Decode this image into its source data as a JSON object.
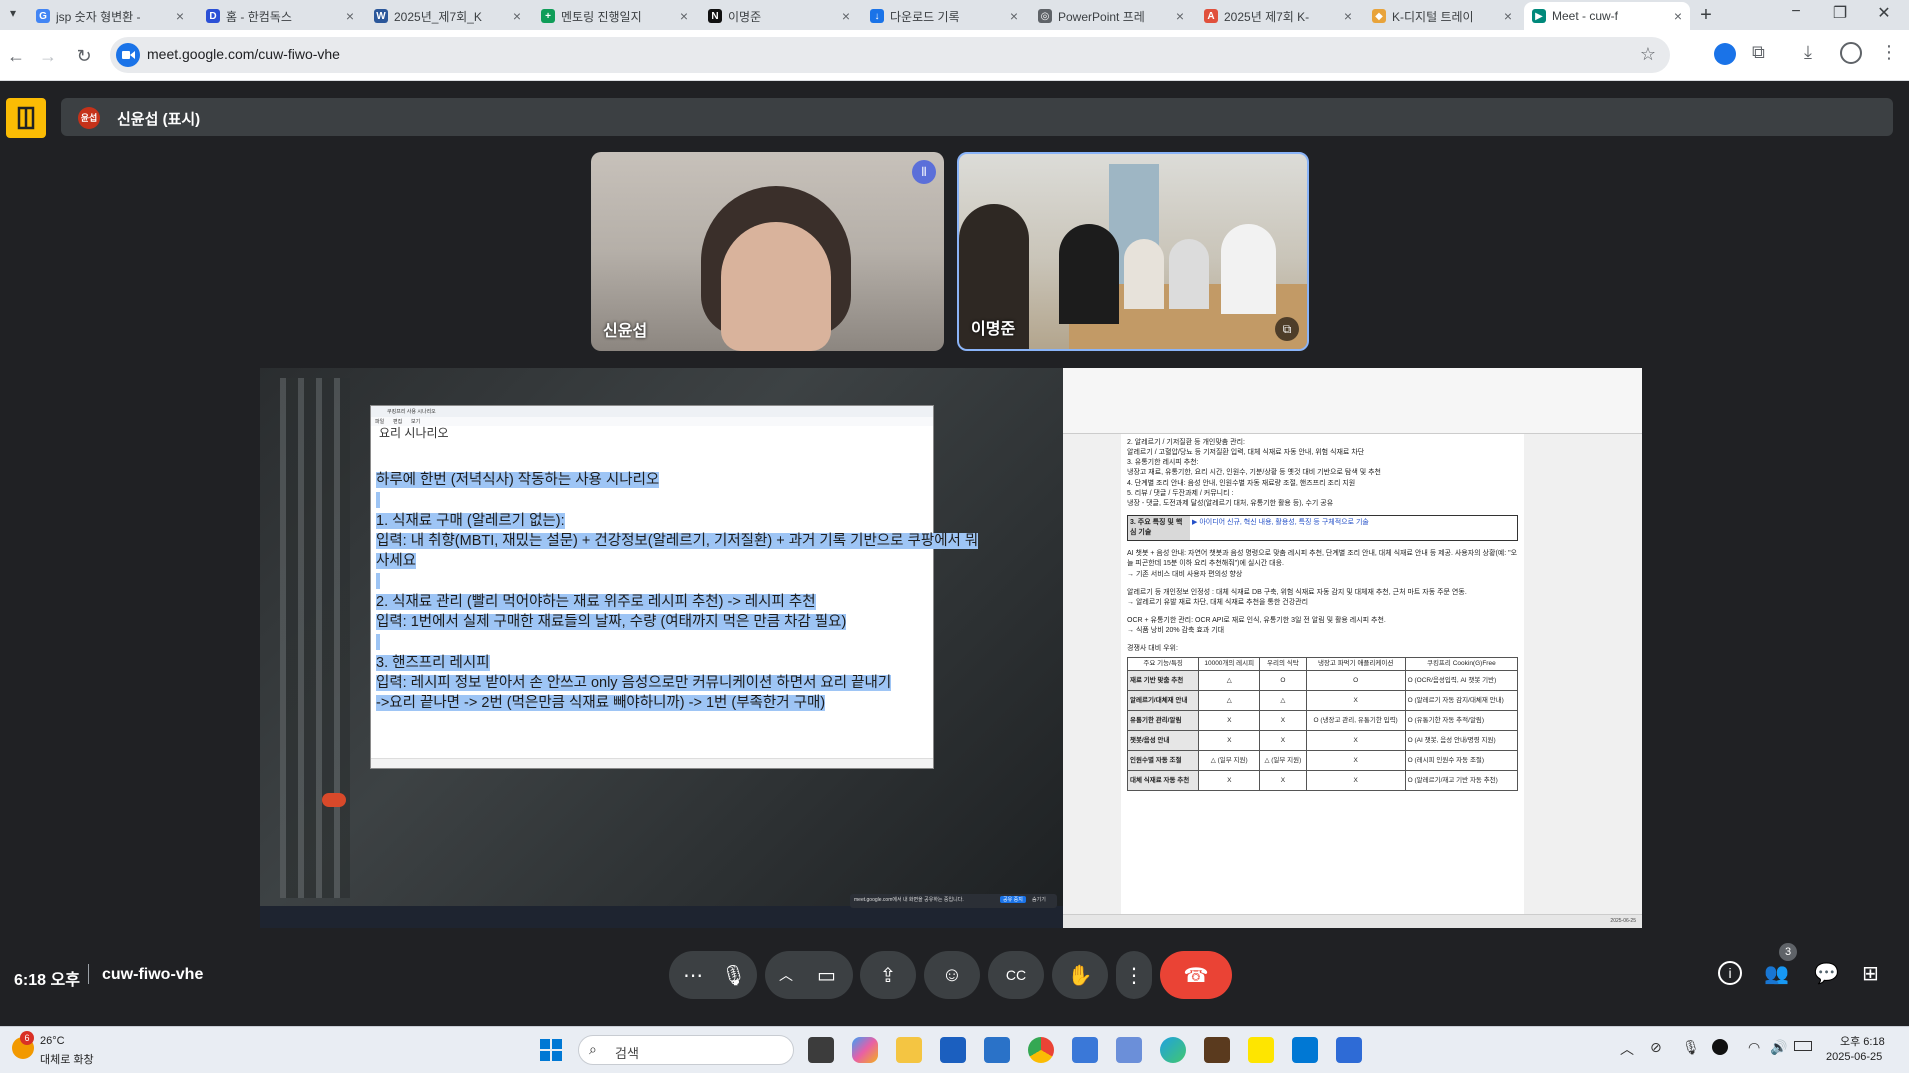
{
  "browser": {
    "tabs": [
      {
        "title": "jsp 숫자 형변환 -",
        "favicon": "google-icon",
        "color": "#4285f4",
        "glyph": "G"
      },
      {
        "title": "홈 - 한컴독스",
        "favicon": "hancom-docs-icon",
        "color": "#2b50d6",
        "glyph": "D"
      },
      {
        "title": "2025년_제7회_K",
        "favicon": "word-icon",
        "color": "#2b579a",
        "glyph": "W"
      },
      {
        "title": "멘토링 진행일지",
        "favicon": "sheets-icon",
        "color": "#0f9d58",
        "glyph": "+"
      },
      {
        "title": "이명준",
        "favicon": "notion-icon",
        "color": "#111111",
        "glyph": "N"
      },
      {
        "title": "다운로드 기록",
        "favicon": "download-icon",
        "color": "#1a73e8",
        "glyph": "↓"
      },
      {
        "title": "PowerPoint 프레",
        "favicon": "globe-icon",
        "color": "#5f6368",
        "glyph": "◎"
      },
      {
        "title": "2025년 제7회 K-",
        "favicon": "hwp-icon",
        "color": "#e0503c",
        "glyph": "A"
      },
      {
        "title": "K-디지털 트레이",
        "favicon": "shield-icon",
        "color": "#e8a33a",
        "glyph": "◆"
      },
      {
        "title": "Meet - cuw-f",
        "favicon": "meet-icon",
        "color": "#00897b",
        "glyph": "▶",
        "active": true
      }
    ],
    "url": "meet.google.com/cuw-fiwo-vhe",
    "new_tab_label": "+"
  },
  "meet": {
    "presenter_label": "신윤섭 (표시)",
    "presenter_avatar": "윤섭",
    "participants": [
      {
        "name": "신윤섭",
        "speaking": true
      },
      {
        "name": "이명준",
        "speaking": false
      }
    ],
    "time": "6:18 오후",
    "meeting_code": "cuw-fiwo-vhe",
    "participant_count": "3"
  },
  "shared_screen": {
    "notepad_lines": [
      "하루에 한번 (저녁식사) 작동하는 사용 시나리오",
      "",
      "1. 식재료 구매 (알레르기 없는):",
      "입력: 내 취향(MBTI, 재밌는 설문) + 건강정보(알레르기, 기저질환) + 과거 기록 기반으로 쿠팡에서 뭐",
      "사세요",
      "",
      "2. 식재료 관리 (빨리 먹어야하는 재료 위주로 레시피 추천) -> 레시피 추천",
      "입력: 1번에서 실제 구매한 재료들의 날짜, 수량 (여태까지 먹은 만큼 차감 필요)",
      "",
      "3. 핸즈프리 레시피",
      "입력: 레시피 정보 받아서 손 안쓰고 only 음성으로만 커뮤니케이션 하면서 요리 끝내기",
      "->요리 끝나면 -> 2번 (먹은만큼 식재료 빼야하니까) -> 1번 (부족한거 구매)"
    ],
    "notepad_partial_top": "요리 시나리오",
    "notepad_title": "쿠킹프리 사용 시나리오",
    "notepad_menu": [
      "파일",
      "편집",
      "보기"
    ],
    "doc_lines": [
      "2. 알레르기 / 기저질환 등 개인맞춤 관리:",
      "   알레르기 / 고혈압/당뇨 등 기저질환 입력, 대체 식재료 자동 안내, 위험 식재료 차단",
      "3. 유통기한 레시피 추천:",
      "   냉장고 재료, 유통기한, 요리 시간, 인원수, 기분/상황 등 옛것 대비 기반으로 탐색 및 추천",
      "4. 단계별 조리 안내: 음성 안내, 인원수별 자동 재료량 조절, 핸즈프리 조리 지원",
      "5. 리뷰 / 댓글 / 두잔과제 / 커뮤니티 :",
      "   냉장 - 댓글, 도전과제 달성(알레르기 대처, 유통기한 활용 등), 수기 공유"
    ],
    "doc_section_label": "3. 주요 특징 및 핵심 기술",
    "doc_section_hint": "▶ 아이디어 신규, 혁신 내용, 활용성, 특징 등 구체적으로 기술",
    "doc_para1": "AI 챗봇 + 음성 안내: 자연어 챗봇과 음성 명령으로 맞춤 레시피 추천, 단계별 조리 안내, 대체 식재료 안내 등 제공. 사용자의 상황(예: \"오늘 피곤한데 15분 이하 요리 추천해줘\")에 실시간 대응.",
    "doc_para1b": "→ 기존 서비스 대비 사용자 편의성 향상",
    "doc_para2": "알레르기 등 개인정보 인정성 : 대체 식재료 DB 구축, 위험 식재료 자동 감지 및 대체재 추천, 근처 마트 자동 주문 연동.",
    "doc_para2b": "→ 알레르기 유발 재료 차단, 대체 식재료 추천을 통한 건강관리",
    "doc_para3": "OCR + 유통기한 관리: OCR API로 재료 인식, 유통기한 3일 전 알림 및 활용 레시피 추천.",
    "doc_para3b": "→ 식품 낭비 20% 감축 효과 기대",
    "doc_table_caption": "경쟁사 대비 우위:",
    "doc_table_headers": [
      "주요 기능/특징",
      "10000개의 레시피",
      "우리의 식탁",
      "냉장고 파먹기 애플리케이션",
      "쿠킹프리 Cookin(G)Free"
    ],
    "doc_table_rows": [
      [
        "재료 기반 맞춤 추천",
        "△",
        "O",
        "O",
        "O (OCR/음성입력, AI 챗봇 기반)"
      ],
      [
        "알레르기/대체재 안내",
        "△",
        "△",
        "X",
        "O (알레르기 자동 감지/대체재 안내)"
      ],
      [
        "유통기한 관리/알림",
        "X",
        "X",
        "O (냉장고 관리, 유통기한 입력)",
        "O (유통기한 자동 추적/알림)"
      ],
      [
        "챗봇/음성 안내",
        "X",
        "X",
        "X",
        "O (AI 챗봇, 음성 안내/명령 지원)"
      ],
      [
        "인원수별 자동 조절",
        "△ (일부 지원)",
        "△ (일부 지원)",
        "X",
        "O (레시피 인원수 자동 조절)"
      ],
      [
        "대체 식재료 자동 추천",
        "X",
        "X",
        "X",
        "O (알레르기/재고 기반 자동 추천)"
      ]
    ],
    "mini_tray_time": "2025-06-25",
    "mini_share_text": "meet.google.com에서 내 화면을 공유하는 중입니다.",
    "mini_share_stop": "공유 중지",
    "mini_share_hide": "숨기기"
  },
  "taskbar": {
    "weather_temp": "26°C",
    "weather_desc": "대체로 화창",
    "weather_badge": "6",
    "search_placeholder": "검색",
    "clock_time": "오후 6:18",
    "clock_date": "2025-06-25"
  },
  "colors": {
    "meet_bg": "#202124",
    "end_call_red": "#ea4335",
    "selection_blue": "#9ec5f5",
    "accent_blue": "#8ab4f8"
  }
}
